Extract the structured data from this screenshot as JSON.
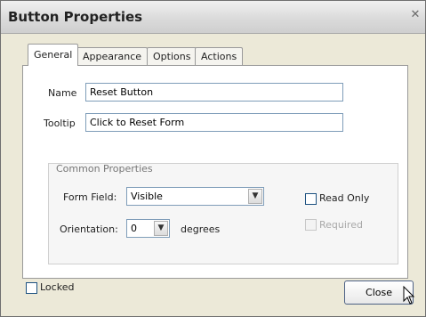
{
  "window": {
    "title": "Button Properties",
    "close_glyph": "✕"
  },
  "tabs": [
    {
      "label": "General",
      "active": true
    },
    {
      "label": "Appearance",
      "active": false
    },
    {
      "label": "Options",
      "active": false
    },
    {
      "label": "Actions",
      "active": false
    }
  ],
  "general": {
    "name_label": "Name",
    "name_value": "Reset Button",
    "tooltip_label": "Tooltip",
    "tooltip_value": "Click to Reset Form"
  },
  "common_properties": {
    "group_title": "Common Properties",
    "form_field_label": "Form Field:",
    "form_field_value": "Visible",
    "orientation_label": "Orientation:",
    "orientation_value": "0",
    "degrees_label": "degrees",
    "read_only_label": "Read Only",
    "read_only_checked": false,
    "required_label": "Required",
    "required_checked": false,
    "required_enabled": false
  },
  "footer": {
    "locked_label": "Locked",
    "locked_checked": false,
    "close_label": "Close"
  },
  "icons": {
    "dropdown_arrow": "▼",
    "cursor": "mouse-pointer-icon"
  }
}
